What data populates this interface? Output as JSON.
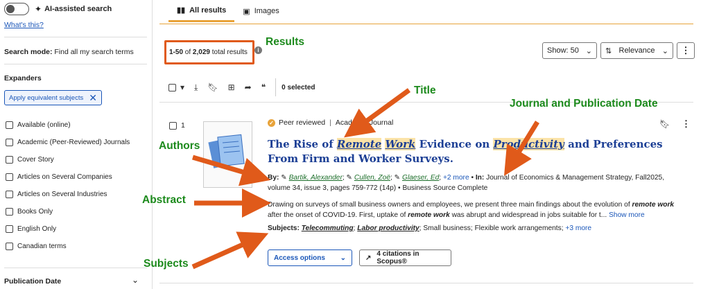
{
  "sidebar": {
    "ai_search_label": "AI-assisted search",
    "whats_this": "What's this?",
    "search_mode_label": "Search mode:",
    "search_mode_value": "Find all my search terms",
    "expanders_heading": "Expanders",
    "chip_label": "Apply equivalent subjects",
    "facets": [
      "Available (online)",
      "Academic (Peer-Reviewed) Journals",
      "Cover Story",
      "Articles on Several Companies",
      "Articles on Several Industries",
      "Books Only",
      "English Only",
      "Canadian terms"
    ],
    "publication_date": "Publication Date"
  },
  "tabs": [
    {
      "label": "All results",
      "icon": "book-icon"
    },
    {
      "label": "Images",
      "icon": "image-icon"
    }
  ],
  "results": {
    "range": "1-50",
    "of_label": "of",
    "total": "2,029",
    "total_suffix": "total results"
  },
  "controls": {
    "show_label": "Show: 50",
    "sort_label": "Relevance",
    "selected_count": "0 selected"
  },
  "annotations": {
    "results": "Results",
    "title": "Title",
    "journal": "Journal and Publication Date",
    "authors": "Authors",
    "abstract": "Abstract",
    "subjects": "Subjects"
  },
  "record": {
    "index": "1",
    "peer_reviewed": "Peer reviewed",
    "type": "Academic Journal",
    "title_parts": [
      {
        "t": "The Rise of ",
        "hl": false
      },
      {
        "t": "Remote",
        "hl": true
      },
      {
        "t": " ",
        "hl": false
      },
      {
        "t": "Work",
        "hl": true
      },
      {
        "t": " Evidence on ",
        "hl": false
      },
      {
        "t": "Productivity",
        "hl": true
      },
      {
        "t": " and Preferences From Firm and Worker Surveys.",
        "hl": false
      }
    ],
    "by_label": "By:",
    "authors": [
      "Bartik, Alexander",
      "Cullen, Zoë",
      "Glaeser, Ed"
    ],
    "more_authors": "+2 more",
    "in_label": "In:",
    "source": "Journal of Economics & Management Strategy, Fall2025, volume 34, issue 3, pages 759-772 (14p)",
    "database": "Business Source Complete",
    "abstract_parts": [
      {
        "t": "Drawing on surveys of small business owners and employees, we present three main findings about the evolution of ",
        "b": false
      },
      {
        "t": "remote work",
        "b": true
      },
      {
        "t": " after the onset of COVID-19. First, uptake of ",
        "b": false
      },
      {
        "t": "remote work",
        "b": true
      },
      {
        "t": " was abrupt and widespread in jobs suitable for t...",
        "b": false
      }
    ],
    "show_more": "Show more",
    "subjects_label": "Subjects:",
    "subjects": [
      {
        "t": "Telecommuting",
        "em": true
      },
      {
        "t": "Labor productivity",
        "em": true
      },
      {
        "t": "Small business",
        "em": false
      },
      {
        "t": "Flexible work arrangements",
        "em": false
      }
    ],
    "more_subjects": "+3 more",
    "access_label": "Access options",
    "citations_label": "4 citations in Scopus®"
  },
  "colors": {
    "annotation": "#1c8a1c",
    "arrow": "#e05a1a",
    "link": "#1a56b8",
    "title": "#1c3f95",
    "highlight": "#fbe3a8"
  }
}
